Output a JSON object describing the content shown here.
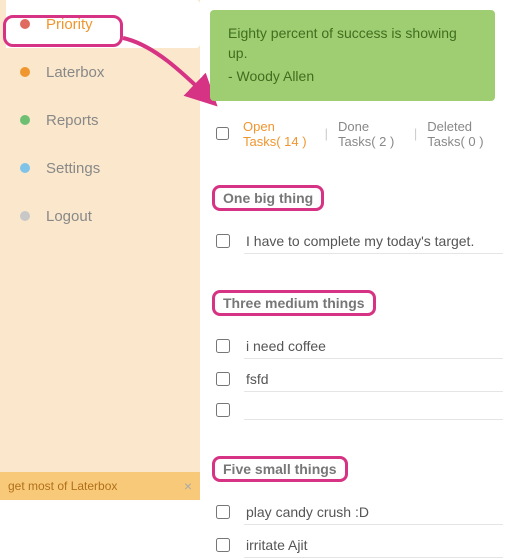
{
  "sidebar": {
    "items": [
      {
        "label": "Priority",
        "dot": "#e06a5f",
        "active": true
      },
      {
        "label": "Laterbox",
        "dot": "#f0962f",
        "active": false
      },
      {
        "label": "Reports",
        "dot": "#6fbf73",
        "active": false
      },
      {
        "label": "Settings",
        "dot": "#7fc4e8",
        "active": false
      },
      {
        "label": "Logout",
        "dot": "#c8c8c8",
        "active": false
      }
    ],
    "footer": "get most of Laterbox"
  },
  "quote": {
    "text": "Eighty percent of success is showing up.",
    "author": "- Woody Allen"
  },
  "filters": {
    "open": "Open Tasks( 14 )",
    "done": "Done Tasks( 2 )",
    "deleted": "Deleted Tasks( 0 )"
  },
  "sections": {
    "big": {
      "title": "One big thing",
      "tasks": [
        "I have to complete my today's target."
      ]
    },
    "medium": {
      "title": "Three medium things",
      "tasks": [
        "i need coffee",
        "fsfd",
        ""
      ]
    },
    "small": {
      "title": "Five small things",
      "tasks": [
        "play candy crush :D",
        "irritate Ajit"
      ]
    }
  }
}
